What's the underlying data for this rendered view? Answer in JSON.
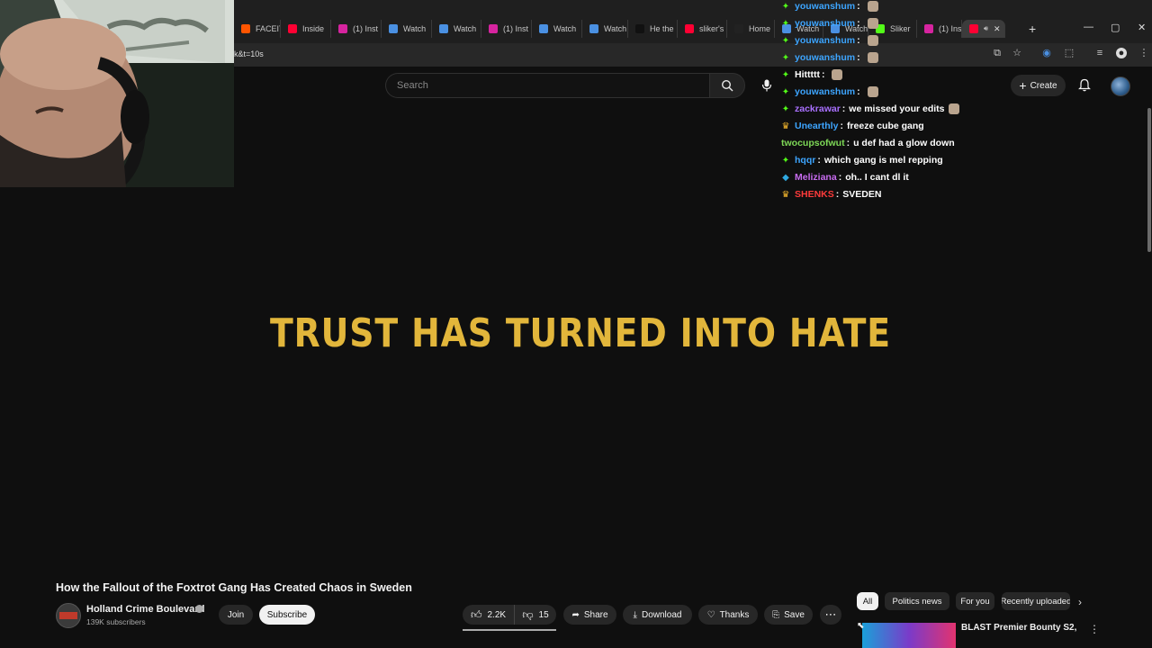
{
  "browser": {
    "tabs": [
      {
        "label": "FACEIT",
        "icon_color": "#ff5500"
      },
      {
        "label": "Inside",
        "icon_color": "#ff0033"
      },
      {
        "label": "(1) Inst",
        "icon_color": "#d6249f"
      },
      {
        "label": "Watch",
        "icon_color": "#4a90e2"
      },
      {
        "label": "Watch",
        "icon_color": "#4a90e2"
      },
      {
        "label": "(1) Inst",
        "icon_color": "#d6249f"
      },
      {
        "label": "Watch",
        "icon_color": "#4a90e2"
      },
      {
        "label": "Watch",
        "icon_color": "#4a90e2"
      },
      {
        "label": "He the",
        "icon_color": "#111111"
      },
      {
        "label": "sliker's",
        "icon_color": "#ff0033"
      },
      {
        "label": "Home",
        "icon_color": "#222222"
      },
      {
        "label": "Watch",
        "icon_color": "#4a90e2"
      },
      {
        "label": "Watch",
        "icon_color": "#4a90e2"
      },
      {
        "label": "Sliker",
        "icon_color": "#53fc18"
      },
      {
        "label": "(1) Inst",
        "icon_color": "#d6249f"
      },
      {
        "label": "",
        "icon_color": "#ff0033",
        "active": true
      }
    ],
    "url": "k&t=10s"
  },
  "youtube": {
    "search_placeholder": "Search",
    "create_label": "Create"
  },
  "video": {
    "title_card": "TRUST HAS TURNED INTO HATE",
    "title": "How the Fallout of the Foxtrot Gang Has Created Chaos in Sweden",
    "channel": {
      "name": "Holland Crime Boulevard",
      "subscribers": "139K subscribers"
    },
    "join_label": "Join",
    "subscribe_label": "Subscribe",
    "likes": "2.2K",
    "dislikes": "15",
    "share_label": "Share",
    "download_label": "Download",
    "thanks_label": "Thanks",
    "save_label": "Save"
  },
  "chat": [
    {
      "badge": "✦",
      "badge_color": "#53fc18",
      "user": "youwanshum",
      "color": "#3da5ff",
      "msg": "",
      "emote": true
    },
    {
      "badge": "✦",
      "badge_color": "#53fc18",
      "user": "youwanshum",
      "color": "#3da5ff",
      "msg": "",
      "emote": true
    },
    {
      "badge": "✦",
      "badge_color": "#53fc18",
      "user": "youwanshum",
      "color": "#3da5ff",
      "msg": "",
      "emote": true
    },
    {
      "badge": "✦",
      "badge_color": "#53fc18",
      "user": "youwanshum",
      "color": "#3da5ff",
      "msg": "",
      "emote": true
    },
    {
      "badge": "✦",
      "badge_color": "#53fc18",
      "user": "Hittttt",
      "color": "#ffffff",
      "msg": "",
      "emote": true
    },
    {
      "badge": "✦",
      "badge_color": "#53fc18",
      "user": "youwanshum",
      "color": "#3da5ff",
      "msg": "",
      "emote": true
    },
    {
      "badge": "✦",
      "badge_color": "#53fc18",
      "user": "zackrawar",
      "color": "#a970ff",
      "msg": "we missed your edits",
      "emote": true
    },
    {
      "badge": "♛",
      "badge_color": "#f5b82e",
      "user": "Unearthly",
      "color": "#3da5ff",
      "msg": "freeze cube gang",
      "emote": false
    },
    {
      "badge": "",
      "badge_color": "#ffffff",
      "user": "twocupsofwut",
      "color": "#7ed957",
      "msg": "u def had a glow down",
      "emote": false
    },
    {
      "badge": "✦",
      "badge_color": "#53fc18",
      "user": "hqqr",
      "color": "#3da5ff",
      "msg": "which gang is mel repping",
      "emote": false
    },
    {
      "badge": "◆",
      "badge_color": "#2fa8e0",
      "user": "Meliziana",
      "color": "#c86cf0",
      "msg": "oh.. I cant dl it",
      "emote": false
    },
    {
      "badge": "♛",
      "badge_color": "#f5b82e",
      "user": "SHENKS",
      "color": "#ff3b3b",
      "msg": "SVEDEN",
      "emote": false
    }
  ],
  "sidebar": {
    "chips": [
      "All",
      "Politics news",
      "For you",
      "Recently uploaded"
    ],
    "recommendation_title": "BLAST Premier Bounty S2,"
  }
}
